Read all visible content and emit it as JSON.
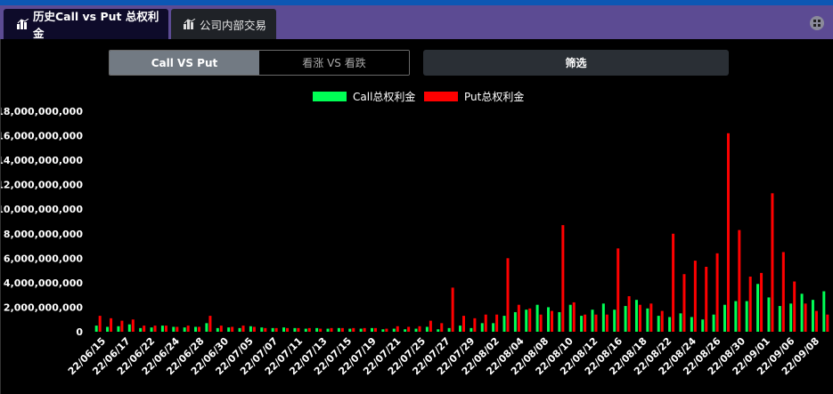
{
  "tabs": [
    {
      "label": "历史Call vs Put 总权利金",
      "icon": "bar-chart-icon",
      "active": true
    },
    {
      "label": "公司内部交易",
      "icon": "bar-chart-icon",
      "active": false
    }
  ],
  "toggle": {
    "options": [
      "Call VS Put",
      "看涨 VS 看跌"
    ],
    "selected": 0
  },
  "filter": {
    "label": "筛选"
  },
  "colors": {
    "call": "#00ff55",
    "put": "#ff0000",
    "tabbar": "#5c4b93",
    "active_tab": "#0e0b2a"
  },
  "chart_data": {
    "type": "bar",
    "legend": [
      "Call总权利金",
      "Put总权利金"
    ],
    "legend_position": "top-center",
    "ylim": [
      0,
      18000000000
    ],
    "yticks": [
      0,
      2000000000,
      4000000000,
      6000000000,
      8000000000,
      10000000000,
      12000000000,
      14000000000,
      16000000000,
      18000000000
    ],
    "ytick_labels": [
      "0",
      "2,000,000,000",
      "4,000,000,000",
      "6,000,000,000",
      "8,000,000,000",
      "10,000,000,000",
      "12,000,000,000",
      "14,000,000,000",
      "16,000,000,000",
      "18,000,000,000"
    ],
    "xtick_labels": [
      "22/06/15",
      "22/06/17",
      "22/06/22",
      "22/06/24",
      "22/06/28",
      "22/06/30",
      "22/07/05",
      "22/07/07",
      "22/07/11",
      "22/07/13",
      "22/07/15",
      "22/07/19",
      "22/07/21",
      "22/07/25",
      "22/07/27",
      "22/07/29",
      "22/08/02",
      "22/08/04",
      "22/08/08",
      "22/08/10",
      "22/08/12",
      "22/08/16",
      "22/08/18",
      "22/08/22",
      "22/08/24",
      "22/08/26",
      "22/08/30",
      "22/09/01",
      "22/09/06",
      "22/09/08"
    ],
    "grid": false,
    "series": [
      {
        "name": "Call总权利金",
        "values": [
          500000000,
          400000000,
          450000000,
          600000000,
          300000000,
          350000000,
          500000000,
          400000000,
          350000000,
          400000000,
          700000000,
          300000000,
          350000000,
          300000000,
          450000000,
          350000000,
          300000000,
          350000000,
          300000000,
          250000000,
          300000000,
          250000000,
          300000000,
          250000000,
          250000000,
          300000000,
          200000000,
          250000000,
          200000000,
          250000000,
          400000000,
          200000000,
          300000000,
          500000000,
          300000000,
          700000000,
          700000000,
          1300000000,
          1600000000,
          1800000000,
          2200000000,
          2000000000,
          1600000000,
          2200000000,
          1300000000,
          1800000000,
          2300000000,
          1800000000,
          2100000000,
          2600000000,
          1900000000,
          1300000000,
          1200000000,
          1500000000,
          1200000000,
          1000000000,
          1400000000,
          2200000000,
          2500000000,
          2500000000,
          3900000000,
          2800000000,
          2100000000,
          2300000000,
          3100000000,
          2600000000,
          3300000000
        ]
      },
      {
        "name": "Put总权利金",
        "values": [
          1300000000,
          1100000000,
          900000000,
          1000000000,
          500000000,
          500000000,
          500000000,
          400000000,
          500000000,
          400000000,
          1300000000,
          500000000,
          400000000,
          500000000,
          400000000,
          300000000,
          300000000,
          300000000,
          300000000,
          300000000,
          250000000,
          300000000,
          300000000,
          300000000,
          300000000,
          300000000,
          250000000,
          450000000,
          400000000,
          450000000,
          900000000,
          700000000,
          3600000000,
          1300000000,
          1100000000,
          1400000000,
          1400000000,
          6000000000,
          2200000000,
          1900000000,
          1400000000,
          1700000000,
          8700000000,
          2400000000,
          1400000000,
          1400000000,
          1400000000,
          6800000000,
          2900000000,
          2200000000,
          2300000000,
          1700000000,
          8000000000,
          4700000000,
          5800000000,
          5300000000,
          6400000000,
          16200000000,
          8300000000,
          4500000000,
          4800000000,
          11300000000,
          6500000000,
          4100000000,
          2300000000,
          1700000000,
          1400000000
        ]
      }
    ]
  }
}
